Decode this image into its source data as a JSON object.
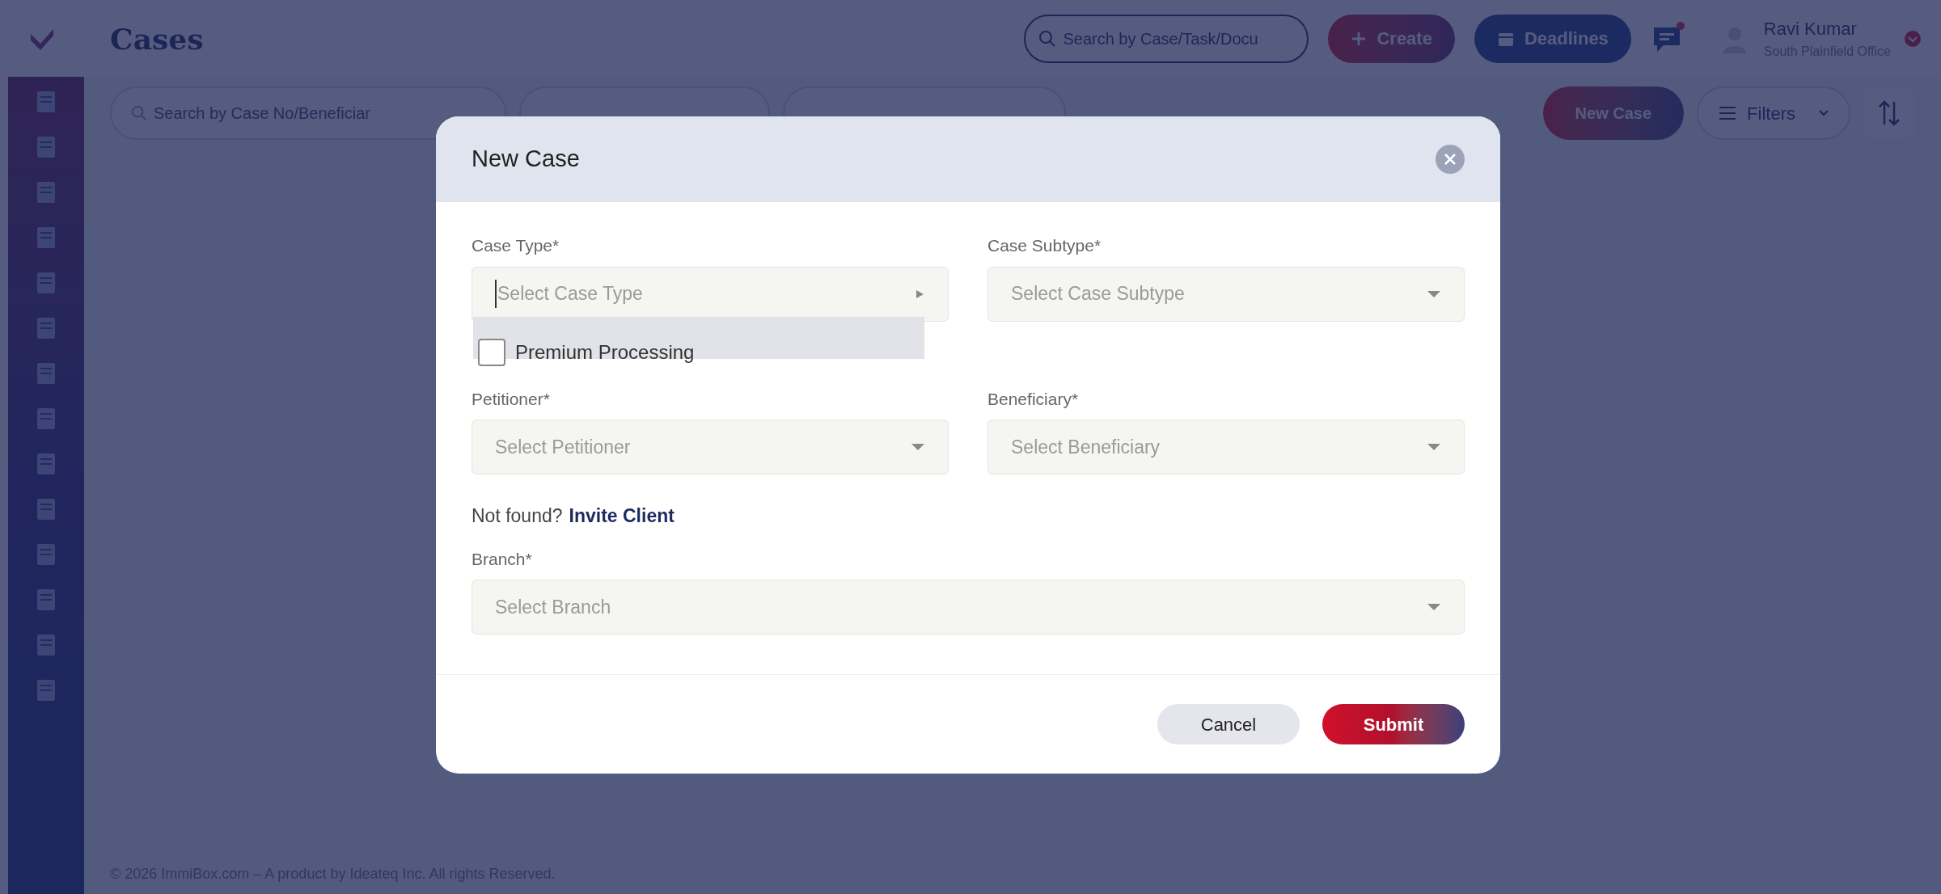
{
  "app_bar": {
    "title": "Cases",
    "search_placeholder": "Search by Case/Task/Docu",
    "buttons": [
      {
        "kind": "create",
        "label": "Create"
      },
      {
        "kind": "deadlines",
        "label": "Deadlines"
      }
    ],
    "user": {
      "name": "Ravi Kumar",
      "office": "South Plainfield Office"
    }
  },
  "toolbar": {
    "search_placeholder": "Search by Case No/Beneficiar",
    "new_case": "New Case",
    "filters": "Filters"
  },
  "footer": "© 2026 ImmiBox.com – A product by Ideateq Inc. All rights Reserved.",
  "modal": {
    "title": "New Case",
    "fields": [
      {
        "label": "Case Type*",
        "placeholder": "Select Case Type",
        "open": true
      },
      {
        "label": "Case Subtype*",
        "placeholder": "Select Case Subtype",
        "open": false
      },
      {
        "label": "Petitioner*",
        "placeholder": "Select Petitioner",
        "open": false
      },
      {
        "label": "Beneficiary*",
        "placeholder": "Select Beneficiary",
        "open": false
      },
      {
        "label": "Branch*",
        "placeholder": "Select Branch",
        "open": false
      }
    ],
    "premium_processing": {
      "label": "Premium Processing",
      "checked": false
    },
    "invite": {
      "prefix": "Not found?",
      "link": "Invite Client"
    },
    "buttons": [
      {
        "kind": "cancel",
        "label": "Cancel"
      },
      {
        "kind": "submit",
        "label": "Submit"
      }
    ]
  }
}
